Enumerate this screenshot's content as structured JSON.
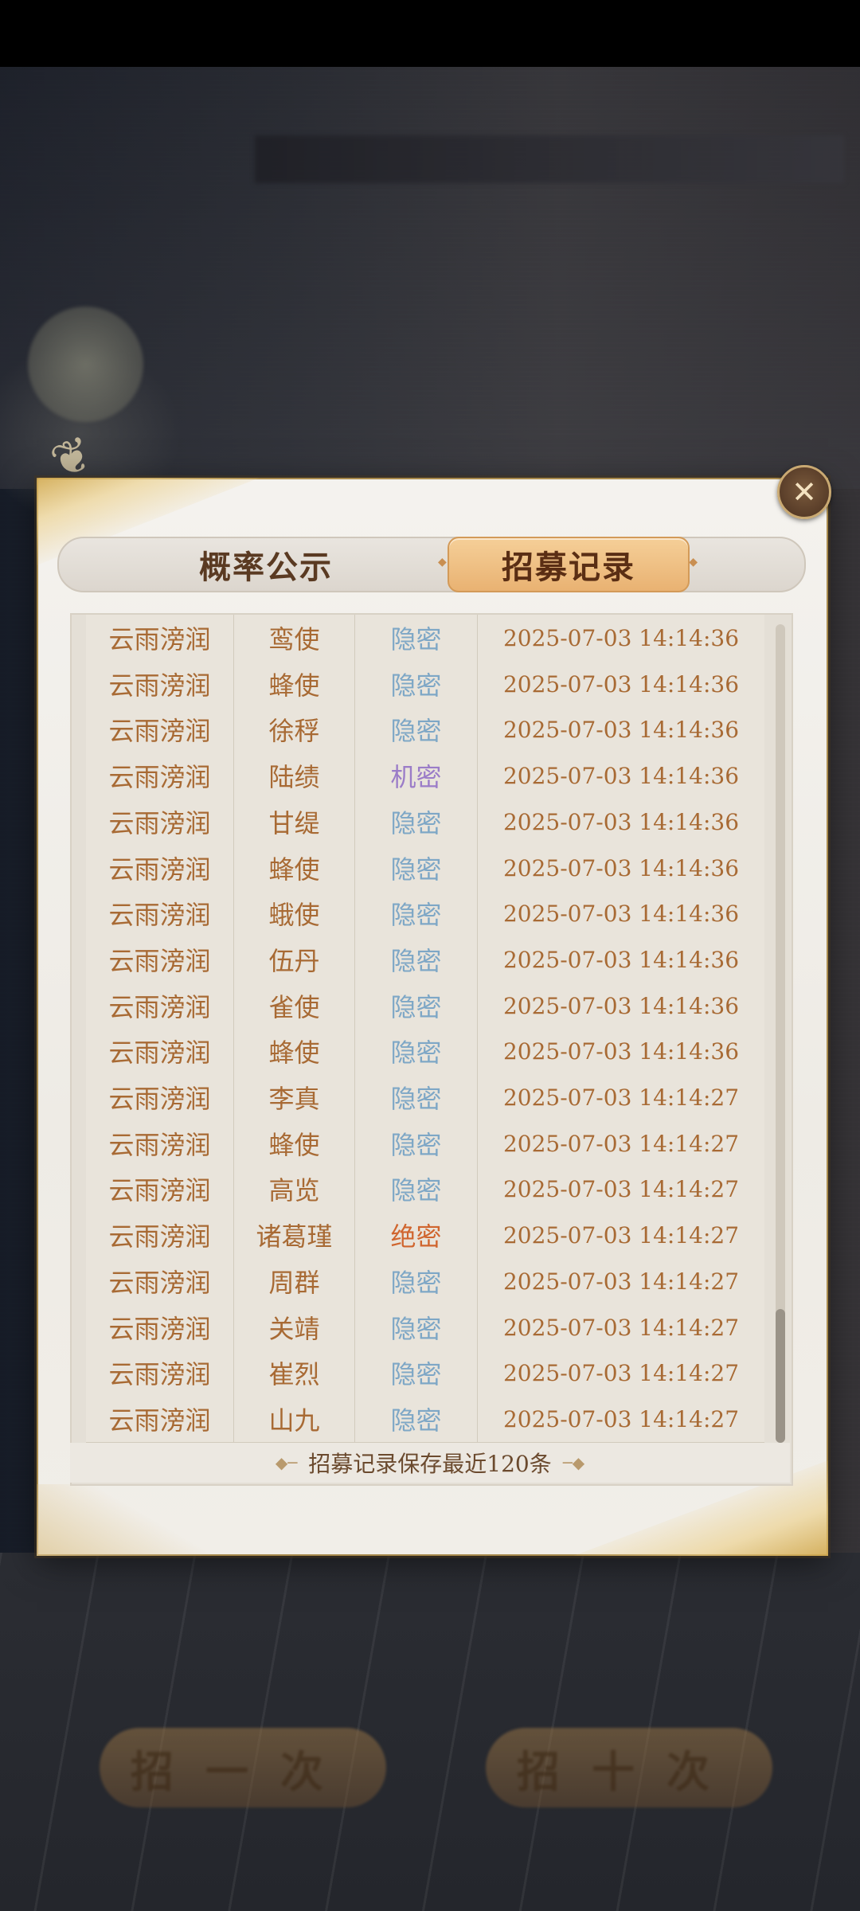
{
  "tabs": {
    "probability_label": "概率公示",
    "records_label": "招募记录"
  },
  "background_buttons": {
    "left_label": "招一次",
    "right_label": "招十次"
  },
  "records": [
    {
      "player": "云雨滂润",
      "hero": "鸾使",
      "rank": "隐密",
      "time": "2025-07-03 14:14:36"
    },
    {
      "player": "云雨滂润",
      "hero": "蜂使",
      "rank": "隐密",
      "time": "2025-07-03 14:14:36"
    },
    {
      "player": "云雨滂润",
      "hero": "徐稃",
      "rank": "隐密",
      "time": "2025-07-03 14:14:36"
    },
    {
      "player": "云雨滂润",
      "hero": "陆绩",
      "rank": "机密",
      "time": "2025-07-03 14:14:36"
    },
    {
      "player": "云雨滂润",
      "hero": "甘缇",
      "rank": "隐密",
      "time": "2025-07-03 14:14:36"
    },
    {
      "player": "云雨滂润",
      "hero": "蜂使",
      "rank": "隐密",
      "time": "2025-07-03 14:14:36"
    },
    {
      "player": "云雨滂润",
      "hero": "蛾使",
      "rank": "隐密",
      "time": "2025-07-03 14:14:36"
    },
    {
      "player": "云雨滂润",
      "hero": "伍丹",
      "rank": "隐密",
      "time": "2025-07-03 14:14:36"
    },
    {
      "player": "云雨滂润",
      "hero": "雀使",
      "rank": "隐密",
      "time": "2025-07-03 14:14:36"
    },
    {
      "player": "云雨滂润",
      "hero": "蜂使",
      "rank": "隐密",
      "time": "2025-07-03 14:14:36"
    },
    {
      "player": "云雨滂润",
      "hero": "李真",
      "rank": "隐密",
      "time": "2025-07-03 14:14:27"
    },
    {
      "player": "云雨滂润",
      "hero": "蜂使",
      "rank": "隐密",
      "time": "2025-07-03 14:14:27"
    },
    {
      "player": "云雨滂润",
      "hero": "高览",
      "rank": "隐密",
      "time": "2025-07-03 14:14:27"
    },
    {
      "player": "云雨滂润",
      "hero": "诸葛瑾",
      "rank": "绝密",
      "time": "2025-07-03 14:14:27"
    },
    {
      "player": "云雨滂润",
      "hero": "周群",
      "rank": "隐密",
      "time": "2025-07-03 14:14:27"
    },
    {
      "player": "云雨滂润",
      "hero": "关靖",
      "rank": "隐密",
      "time": "2025-07-03 14:14:27"
    },
    {
      "player": "云雨滂润",
      "hero": "崔烈",
      "rank": "隐密",
      "time": "2025-07-03 14:14:27"
    },
    {
      "player": "云雨滂润",
      "hero": "山九",
      "rank": "隐密",
      "time": "2025-07-03 14:14:27"
    }
  ],
  "footer": {
    "note": "招募记录保存最近120条"
  },
  "icons": {
    "close": "close-icon",
    "ornament": "diamond-ornament-icon",
    "bird": "bird-decoration-icon"
  },
  "colors": {
    "rank_hidden": "#7ea7c6",
    "rank_secret": "#9b7cc8",
    "rank_top_secret": "#d0652e",
    "text_brown": "#a86a34",
    "tab_active": "#e9b272"
  }
}
